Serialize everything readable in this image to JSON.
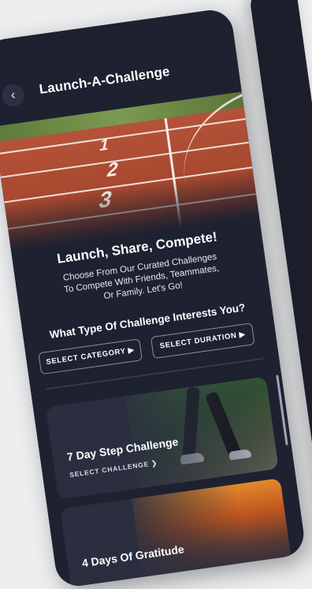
{
  "header": {
    "back_icon": "chevron-left-icon",
    "back_glyph": "‹",
    "title": "Launch-A-Challenge"
  },
  "intro": {
    "headline": "Launch, Share, Compete!",
    "description": "Choose From Our Curated Challenges To Compete  With Friends, Teammates, Or Family. Let's Go!"
  },
  "filters": {
    "question": "What Type Of Challenge Interests You?",
    "category_label": "SELECT CATEGORY ▶",
    "duration_label": "SELECT DURATION ▶"
  },
  "challenges": [
    {
      "title": "7 Day Step Challenge",
      "action": "SELECT CHALLENGE ❯"
    },
    {
      "title": "4 Days Of Gratitude"
    }
  ],
  "colors": {
    "background": "#1e2130",
    "card": "#2a2e3f",
    "text": "#ffffff"
  }
}
